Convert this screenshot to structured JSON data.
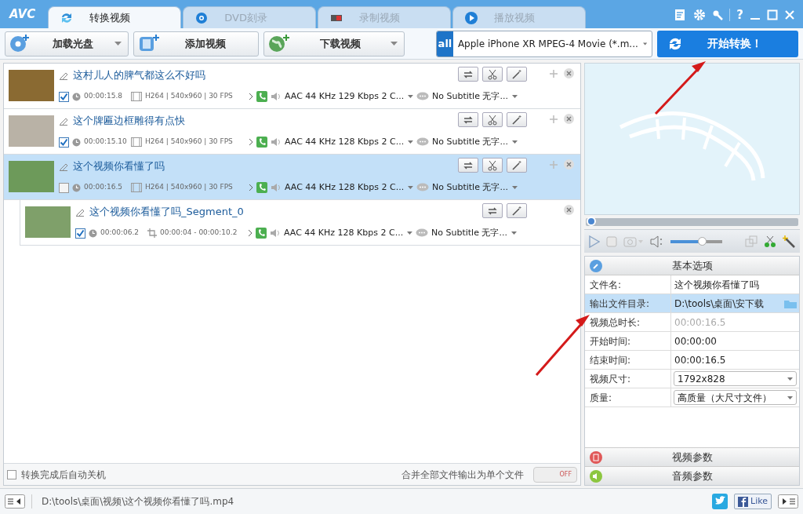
{
  "app_logo": "AVC",
  "tabs": [
    {
      "label": "转换视频",
      "kind": "convert",
      "selected": true
    },
    {
      "label": "DVD刻录",
      "kind": "dvd",
      "selected": false
    },
    {
      "label": "录制视频",
      "kind": "record",
      "selected": false
    },
    {
      "label": "播放视频",
      "kind": "play",
      "selected": false
    }
  ],
  "help_button": "?",
  "toolbar": {
    "buttons": [
      {
        "label": "加载光盘",
        "kind": "disc",
        "dropdown": true
      },
      {
        "label": "添加视频",
        "kind": "film",
        "dropdown": false
      },
      {
        "label": "下载视频",
        "kind": "globe",
        "dropdown": true
      }
    ],
    "profile": {
      "icon_text": "all",
      "label": "Apple iPhone XR MPEG-4 Movie (*.m..."
    },
    "convert_button": "开始转换！"
  },
  "files": [
    {
      "kind": "file",
      "title": "这村儿人的脾气都这么不好吗",
      "checked": true,
      "selected": false,
      "duration": "00:00:15.8",
      "info": "H264 | 540x960 | 30 FPS",
      "audio": "AAC 44 KHz 129 Kbps 2 C...",
      "subtitle": "No Subtitle 无字..."
    },
    {
      "kind": "file",
      "title": "这个牌匾边框雕得有点快",
      "checked": true,
      "selected": false,
      "duration": "00:00:15.10",
      "info": "H264 | 540x960 | 30 FPS",
      "audio": "AAC 44 KHz 128 Kbps 2 C...",
      "subtitle": "No Subtitle 无字..."
    },
    {
      "kind": "file",
      "title": "这个视频你看懂了吗",
      "checked": false,
      "selected": true,
      "duration": "00:00:16.5",
      "info": "H264 | 540x960 | 30 FPS",
      "audio": "AAC 44 KHz 128 Kbps 2 C...",
      "subtitle": "No Subtitle 无字..."
    },
    {
      "kind": "segment",
      "title": "这个视频你看懂了吗_Segment_0",
      "checked": true,
      "selected": false,
      "duration": "00:00:06.2",
      "info": "00:00:04 - 00:00:10.2",
      "audio": "AAC 44 KHz 128 Kbps 2 C...",
      "subtitle": "No Subtitle 无字..."
    }
  ],
  "preview": {
    "seek": {
      "level": 0.02
    },
    "volume": {
      "level": 0.6
    }
  },
  "options": {
    "title": "基本选项",
    "rows": [
      {
        "label": "文件名:",
        "value": "这个视频你看懂了吗",
        "kind": "text",
        "selected": false
      },
      {
        "label": "输出文件目录:",
        "value": "D:\\tools\\桌面\\安下载",
        "kind": "folder",
        "selected": true
      },
      {
        "label": "视频总时长:",
        "value": "00:00:16.5",
        "kind": "readonly",
        "selected": false
      },
      {
        "label": "开始时间:",
        "value": "00:00:00",
        "kind": "text",
        "selected": false
      },
      {
        "label": "结束时间:",
        "value": "00:00:16.5",
        "kind": "text",
        "selected": false
      },
      {
        "label": "视频尺寸:",
        "value": "1792x828",
        "kind": "select",
        "selected": false
      },
      {
        "label": "质量:",
        "value": "高质量（大尺寸文件）",
        "kind": "select",
        "selected": false
      }
    ]
  },
  "sections": [
    {
      "label": "视频参数",
      "kind": "video"
    },
    {
      "label": "音频参数",
      "kind": "audio"
    }
  ],
  "footer": {
    "shutdown": {
      "label": "转换完成后自动关机",
      "checked": false
    },
    "merge": {
      "label": "合并全部文件输出为单个文件",
      "on": false,
      "toggle_label": "OFF"
    }
  },
  "status_bar": {
    "path": "D:\\tools\\桌面\\视频\\这个视频你看懂了吗.mp4",
    "like": "Like"
  }
}
